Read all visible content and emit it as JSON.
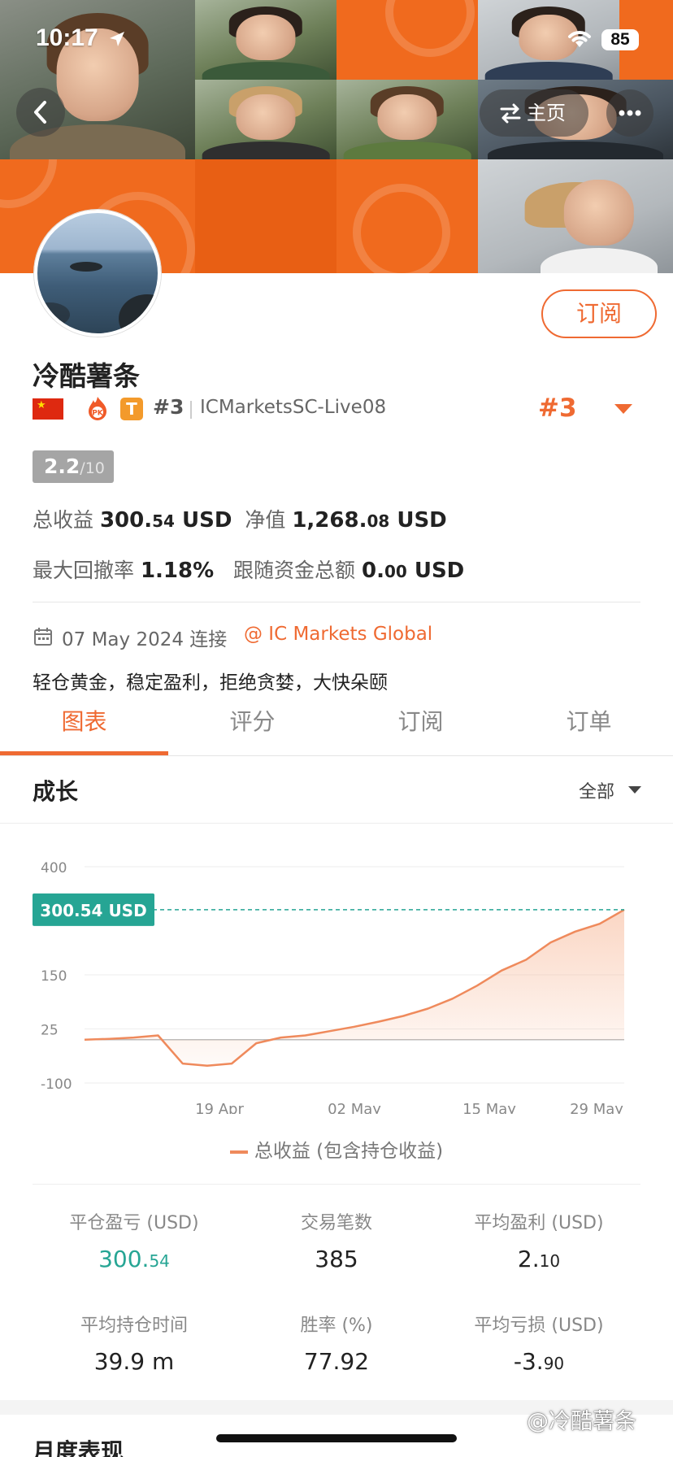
{
  "status_bar": {
    "time": "10:17",
    "battery": "85"
  },
  "header": {
    "home_label": "主页"
  },
  "profile": {
    "subscribe_label": "订阅",
    "username": "冷酷薯条",
    "rank": "#3",
    "server": "ICMarketsSC-Live08",
    "rank_big": "#3",
    "score": "2.2",
    "score_denom": "/10",
    "total_profit_label": "总收益",
    "total_profit_int": "300.",
    "total_profit_dec": "54",
    "total_profit_unit": " USD",
    "equity_label": "净值",
    "equity_int": "1,268.",
    "equity_dec": "08",
    "equity_unit": " USD",
    "max_drawdown_label": "最大回撤率",
    "max_drawdown": "1.18%",
    "follow_funds_label": "跟随资金总额",
    "follow_funds_int": "0.",
    "follow_funds_dec": "00",
    "follow_funds_unit": " USD",
    "connect_date": "07 May 2024 连接",
    "broker": "@ IC Markets Global",
    "bio": "轻仓黄金，稳定盈利，拒绝贪婪，大快朵颐"
  },
  "tabs": [
    "图表",
    "评分",
    "订阅",
    "订单"
  ],
  "growth": {
    "title": "成长",
    "filter": "全部"
  },
  "chart_data": {
    "type": "area",
    "x_ticks": [
      "19 Apr",
      "02 May",
      "15 May",
      "29 May"
    ],
    "y_ticks": [
      "400",
      "150",
      "25",
      "-100"
    ],
    "ylim": [
      -100,
      400
    ],
    "current_label": "300.54 USD",
    "current_value": 300.54,
    "series": [
      {
        "name": "总收益 (包含持仓收益)",
        "values": [
          0,
          2,
          5,
          10,
          -55,
          -60,
          -55,
          -8,
          5,
          10,
          20,
          30,
          42,
          55,
          72,
          95,
          125,
          160,
          185,
          225,
          250,
          268,
          300.54
        ]
      }
    ],
    "legend": "总收益 (包含持仓收益)"
  },
  "stats": [
    {
      "label": "平仓盈亏 (USD)",
      "int": "300.",
      "dec": "54"
    },
    {
      "label": "交易笔数",
      "int": "385",
      "dec": ""
    },
    {
      "label": "平均盈利 (USD)",
      "int": "2.",
      "dec": "10"
    },
    {
      "label": "平均持仓时间",
      "int": "39.9 m",
      "dec": ""
    },
    {
      "label": "胜率 (%)",
      "int": "77.92",
      "dec": ""
    },
    {
      "label": "平均亏损 (USD)",
      "int": "-3.",
      "dec": "90"
    }
  ],
  "monthly_title": "月度表现",
  "watermark": "@冷酷薯条",
  "colors": {
    "accent": "#ef6a32",
    "green": "#26a594",
    "banner_orange": "#f06a1e"
  }
}
